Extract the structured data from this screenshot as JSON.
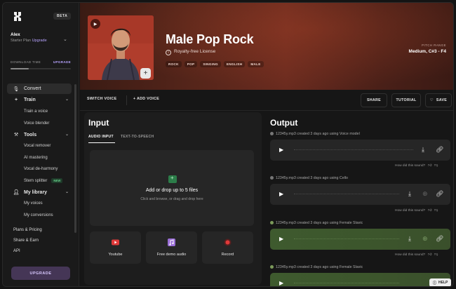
{
  "sidebar": {
    "beta": "BETA",
    "user_name": "Alex",
    "plan_text": "Starter Plan",
    "plan_upgrade": "Upgrade",
    "download_time_label": "DOWNLOAD TIME",
    "download_upgrade": "UPGRADE",
    "download_progress": 0.3,
    "nav": {
      "convert": "Convert",
      "train": "Train",
      "train_voice": "Train a voice",
      "voice_blender": "Voice blender",
      "tools": "Tools",
      "vocal_remover": "Vocal remover",
      "ai_mastering": "AI mastering",
      "vocal_deharmony": "Vocal de-harmony",
      "stem_splitter": "Stem splitter",
      "new_badge": "NEW",
      "my_library": "My library",
      "my_voices": "My voices",
      "my_conversions": "My conversions"
    },
    "plans_pricing": "Plans & Pricing",
    "share_earn": "Share & Earn",
    "api": "API",
    "upgrade_button": "UPGRADE"
  },
  "hero": {
    "title": "Male Pop Rock",
    "license": "Royalty-free License",
    "tags": [
      "ROCK",
      "POP",
      "SINGING",
      "ENGLISH",
      "MALE"
    ],
    "pitch_label": "PITCH RANGE",
    "pitch_value": "Medium, C#3 - F4"
  },
  "toolbar": {
    "switch_voice": "SWITCH VOICE",
    "add_voice": "+ ADD VOICE",
    "share": "SHARE",
    "tutorial": "TUTORIAL",
    "save": "SAVE"
  },
  "input": {
    "title": "Input",
    "tab_audio": "AUDIO INPUT",
    "tab_tts": "TEXT-TO-SPEECH",
    "drop_title": "Add or drop up to 5 files",
    "drop_sub": "Click and browse, or drag and drop here",
    "sources": [
      "Youtube",
      "Free demo audio",
      "Record"
    ]
  },
  "output": {
    "title": "Output",
    "items": [
      {
        "meta": "12345y.mp3 created 3 days ago using Voice model",
        "feedback": "How did this sound?"
      },
      {
        "meta": "12345y.mp3 created 3 days ago using Cello",
        "feedback": "How did this sound?"
      },
      {
        "meta": "12345y.mp3 created 3 days ago using Female Slavic",
        "feedback": "How did this sound?"
      },
      {
        "meta": "12345y.mp3 created 3 days ago using Female Slavic"
      }
    ]
  },
  "help": "HELP",
  "colors": {
    "accent": "#b7a3ff",
    "upgrade_bg": "#453656",
    "new_badge": "#66d08a",
    "green_player": "#3e5a2e",
    "hero": "#6a2b1f"
  }
}
